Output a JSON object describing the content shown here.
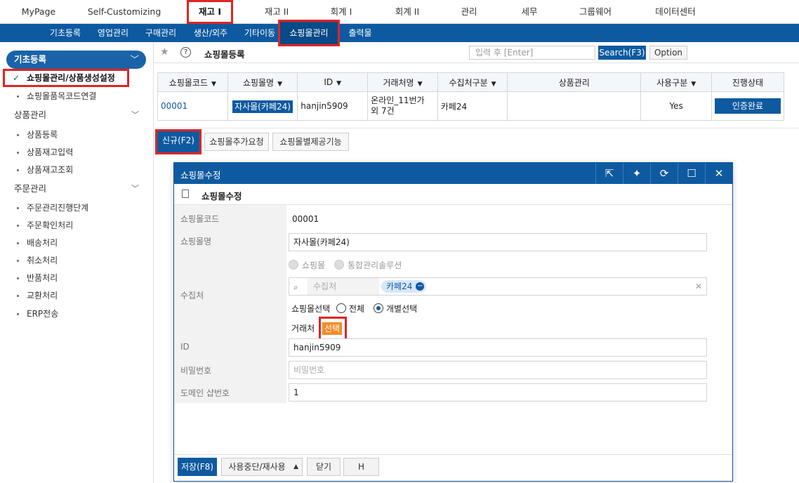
{
  "top_menu": [
    "MyPage",
    "Self-Customizing",
    "재고 I",
    "재고 II",
    "회계 I",
    "회계 II",
    "관리",
    "세무",
    "그룹웨어",
    "데이터센터"
  ],
  "sub_menu": [
    "기초등록",
    "영업관리",
    "구매관리",
    "생산/외주",
    "기타이동",
    "쇼핑몰관리",
    "출력물"
  ],
  "sidebar": {
    "head": "기초등록",
    "items_basic": [
      "쇼핑몰관리/상품생성설정",
      "쇼핑몰품목코드연결"
    ],
    "group_product": "상품관리",
    "items_product": [
      "상품등록",
      "상품재고입력",
      "상품재고조회"
    ],
    "group_order": "주문관리",
    "items_order": [
      "주문관리진행단계",
      "주문확인처리",
      "배송처리",
      "취소처리",
      "반품처리",
      "교환처리",
      "ERP전송"
    ]
  },
  "toolbar": {
    "title": "쇼핑몰등록",
    "search_placeholder": "입력 후 [Enter]",
    "search_label": "Search(F3)",
    "option_label": "Option"
  },
  "grid": {
    "headers": [
      "쇼핑몰코드",
      "쇼핑몰명",
      "ID",
      "거래처명",
      "수집처구분",
      "상품관리",
      "사용구분",
      "진행상태"
    ],
    "row": {
      "code": "00001",
      "mall_name": "자사몰(카페24)",
      "id": "hanjin5909",
      "partner": "온라인_11번가 외 7건",
      "collect": "카페24",
      "product": "",
      "use": "Yes",
      "status": "인증완료"
    }
  },
  "actions": [
    "신규(F2)",
    "쇼핑몰추가요청",
    "쇼핑몰별제공기능"
  ],
  "modal": {
    "title": "쇼핑몰수정",
    "subtitle": "쇼핑몰수정",
    "labels": {
      "code": "쇼핑몰코드",
      "name": "쇼핑몰명",
      "collect": "수집처",
      "id": "ID",
      "password": "비밀번호",
      "shop_no": "도메인 샵번호"
    },
    "values": {
      "code": "00001",
      "name": "자사몰(카페24)",
      "id": "hanjin5909",
      "password_placeholder": "비밀번호",
      "shop_no": "1"
    },
    "radio_type": [
      "쇼핑몰",
      "통합관리솔루션"
    ],
    "collect_placeholder": "수집처",
    "collect_chip": "카페24",
    "mall_select_label": "쇼핑몰선택",
    "mall_select_options": [
      "전체",
      "개별선택"
    ],
    "partner_label": "거래처",
    "select_btn": "선택",
    "footer_buttons": [
      "저장(F8)",
      "사용중단/재사용",
      "닫기",
      "H"
    ]
  }
}
